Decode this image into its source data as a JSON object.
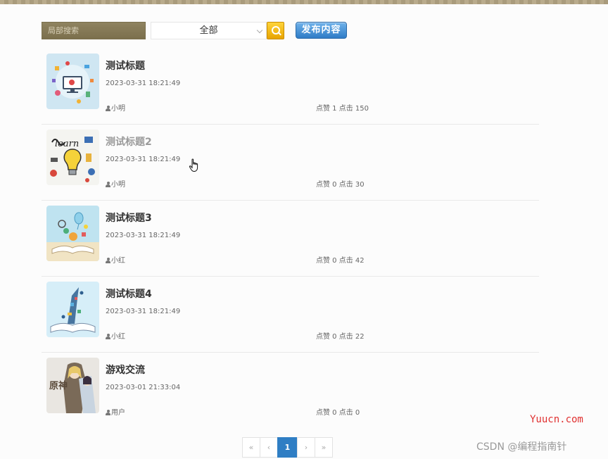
{
  "toolbar": {
    "search_placeholder": "局部搜索",
    "category_value": "全部",
    "publish_label": "发布内容"
  },
  "posts": [
    {
      "title": "测试标题",
      "date": "2023-03-31 18:21:49",
      "author": "小明",
      "stats": "点赞 1 点击 150"
    },
    {
      "title": "测试标题2",
      "date": "2023-03-31 18:21:49",
      "author": "小明",
      "stats": "点赞 0 点击 30"
    },
    {
      "title": "测试标题3",
      "date": "2023-03-31 18:21:49",
      "author": "小红",
      "stats": "点赞 0 点击 42"
    },
    {
      "title": "测试标题4",
      "date": "2023-03-31 18:21:49",
      "author": "小红",
      "stats": "点赞 0 点击 22"
    },
    {
      "title": "游戏交流",
      "date": "2023-03-01 21:33:04",
      "author": "用户",
      "stats": "点赞 0 点击 0"
    }
  ],
  "pagination": {
    "first": "«",
    "prev": "‹",
    "current": "1",
    "next": "›",
    "last": "»"
  },
  "watermarks": {
    "site": "Yuucn.com",
    "csdn": "CSDN @编程指南针"
  },
  "colors": {
    "accent": "#2f7ec4",
    "search_bg": "#8f8360",
    "search_button": "#e8a400"
  }
}
